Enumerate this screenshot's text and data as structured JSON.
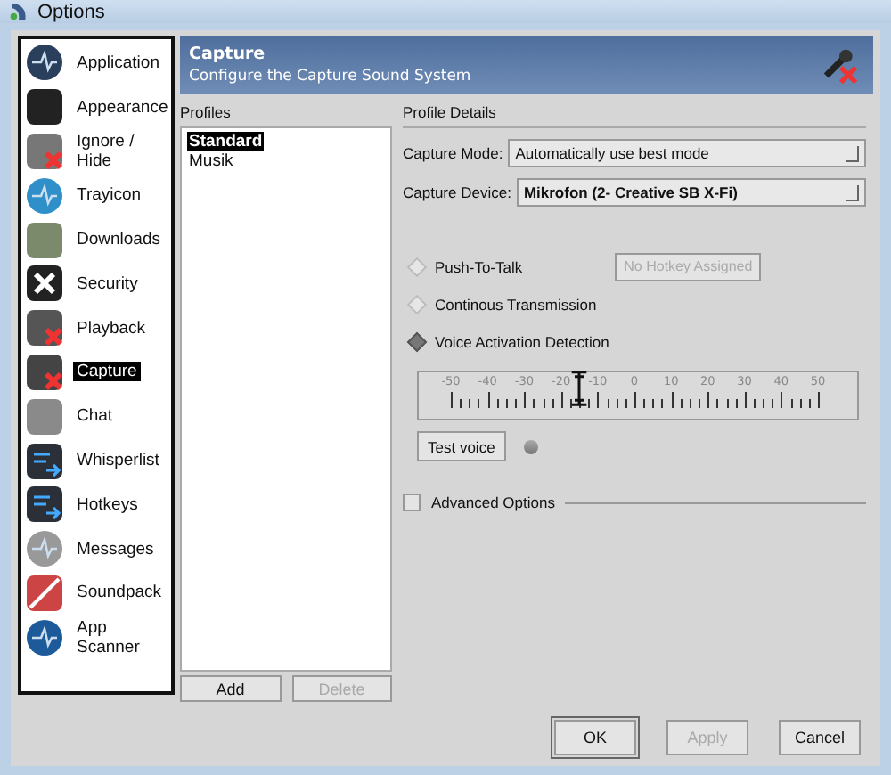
{
  "window": {
    "title": "Options"
  },
  "sidebar": {
    "items": [
      {
        "label": "Application",
        "selected": false
      },
      {
        "label": "Appearance",
        "selected": false
      },
      {
        "label": "Ignore / Hide",
        "selected": false
      },
      {
        "label": "Trayicon",
        "selected": false
      },
      {
        "label": "Downloads",
        "selected": false
      },
      {
        "label": "Security",
        "selected": false
      },
      {
        "label": "Playback",
        "selected": false
      },
      {
        "label": "Capture",
        "selected": true
      },
      {
        "label": "Chat",
        "selected": false
      },
      {
        "label": "Whisperlist",
        "selected": false
      },
      {
        "label": "Hotkeys",
        "selected": false
      },
      {
        "label": "Messages",
        "selected": false
      },
      {
        "label": "Soundpack",
        "selected": false
      },
      {
        "label": "App Scanner",
        "selected": false
      }
    ]
  },
  "header": {
    "title": "Capture",
    "subtitle": "Configure the Capture Sound System"
  },
  "profiles": {
    "label": "Profiles",
    "items": [
      {
        "label": "Standard",
        "selected": true
      },
      {
        "label": "Musik",
        "selected": false
      }
    ],
    "buttons": [
      {
        "label": "Add",
        "disabled": false
      },
      {
        "label": "Delete",
        "disabled": true
      }
    ]
  },
  "details": {
    "label": "Profile Details",
    "capture_mode": {
      "label": "Capture Mode:",
      "value": "Automatically use best mode"
    },
    "capture_device": {
      "label": "Capture Device:",
      "value": "Mikrofon (2- Creative SB X-Fi)"
    },
    "modes": [
      {
        "label": "Push-To-Talk",
        "selected": false
      },
      {
        "label": "Continous Transmission",
        "selected": false
      },
      {
        "label": "Voice Activation Detection",
        "selected": true
      }
    ],
    "hotkey_button": {
      "label": "No Hotkey Assigned",
      "disabled": true
    },
    "threshold": {
      "level": 0.35,
      "scale": [
        "-50",
        "-40",
        "-30",
        "-20",
        "-10",
        "0",
        "10",
        "20",
        "30",
        "40",
        "50"
      ]
    },
    "test_button": {
      "label": "Test voice"
    },
    "advanced": {
      "label": "Advanced Options",
      "checked": false
    }
  },
  "buttons": [
    {
      "label": "OK",
      "disabled": false
    },
    {
      "label": "Apply",
      "disabled": true
    },
    {
      "label": "Cancel",
      "disabled": false
    }
  ]
}
